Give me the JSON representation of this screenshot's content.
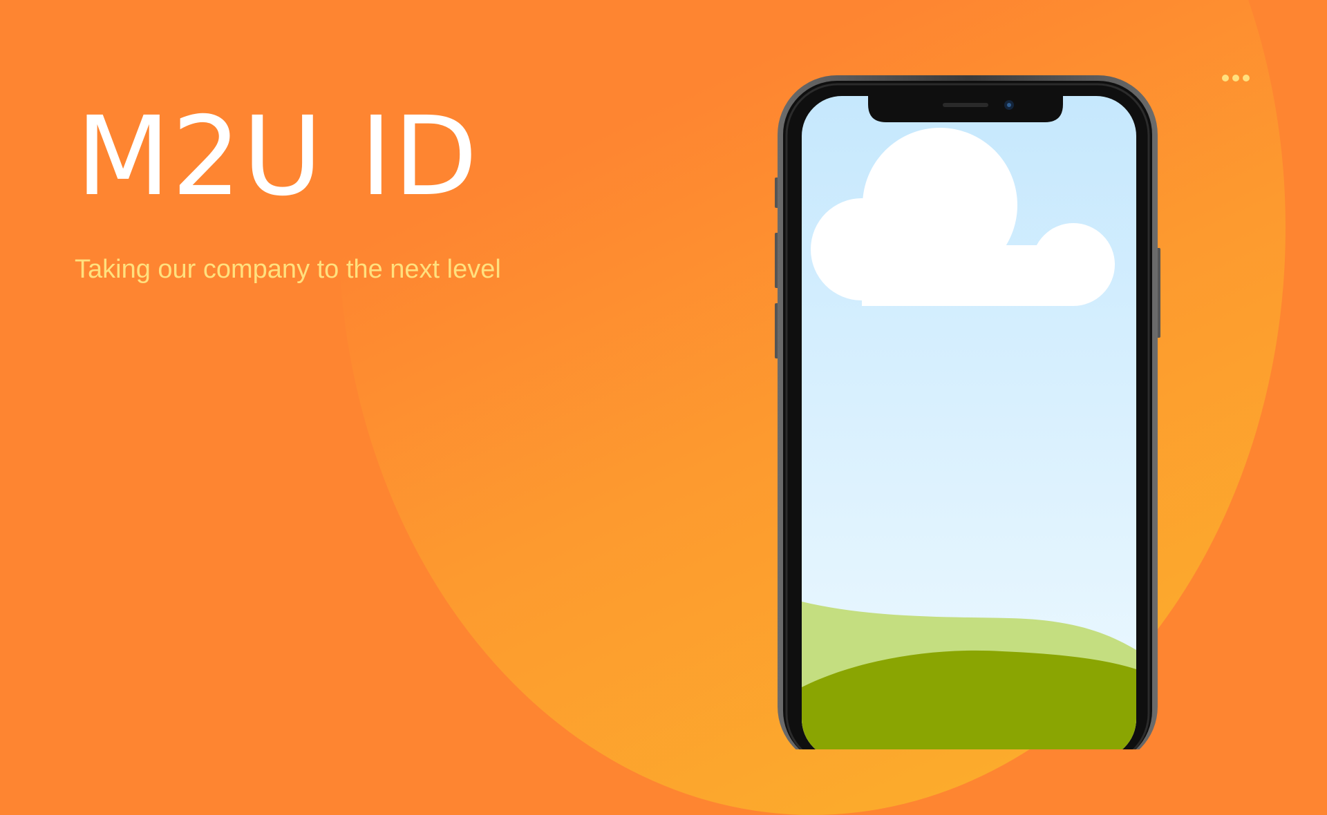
{
  "slide": {
    "title": "M2U ID",
    "subtitle": "Taking our company to the next level"
  },
  "more_menu": {
    "icon": "more-horizontal-icon"
  },
  "device": {
    "type": "smartphone",
    "screen_content": "sky-cloud-hills-illustration"
  },
  "colors": {
    "background": "#fe8531",
    "circle_light": "#fcb22b",
    "title": "#ffffff",
    "subtitle": "#ffe07e",
    "dots": "#ffe07e",
    "sky_top": "#c6e8fd",
    "sky_bottom": "#eef9ff",
    "hill_light": "#c4de80",
    "hill_dark": "#8aa502"
  }
}
